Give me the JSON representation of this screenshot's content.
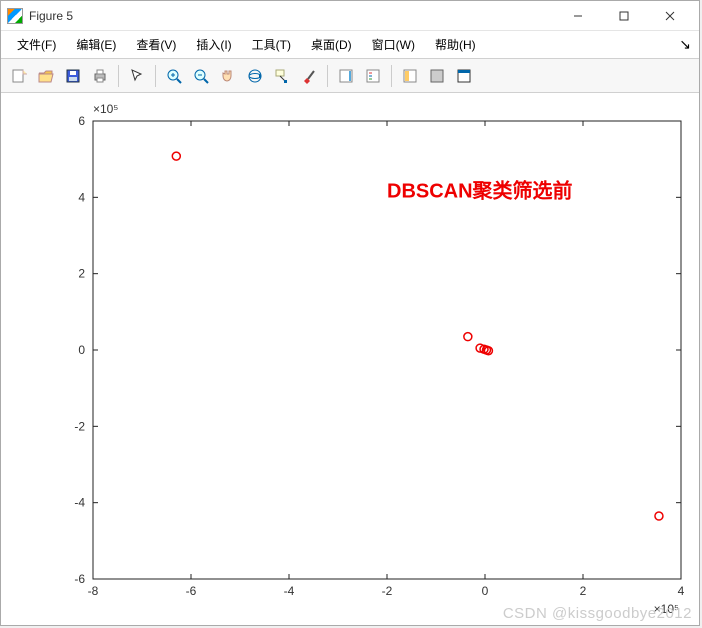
{
  "window": {
    "title": "Figure 5"
  },
  "menu": {
    "file": "文件(F)",
    "edit": "编辑(E)",
    "view": "查看(V)",
    "insert": "插入(I)",
    "tools": "工具(T)",
    "desktop": "桌面(D)",
    "window": "窗口(W)",
    "help": "帮助(H)"
  },
  "toolbar": {
    "icons": [
      "new-figure",
      "open",
      "save",
      "print",
      "pointer",
      "zoom-in",
      "zoom-out",
      "pan",
      "rotate3d",
      "data-cursor",
      "brush",
      "insert-colorbar",
      "insert-legend",
      "link-plot",
      "hide-tools",
      "dock"
    ]
  },
  "watermark": "CSDN @kissgoodbye2012",
  "chart_data": {
    "type": "scatter",
    "title": "",
    "annotation": "DBSCAN聚类筛选前",
    "xlabel": "",
    "ylabel": "",
    "xlim": [
      -8,
      4
    ],
    "ylim": [
      -6,
      6
    ],
    "x_exponent_label": "×10⁵",
    "y_exponent_label": "×10⁵",
    "x_ticks": [
      -8,
      -6,
      -4,
      -2,
      0,
      2,
      4
    ],
    "y_ticks": [
      -6,
      -4,
      -2,
      0,
      2,
      4,
      6
    ],
    "series": [
      {
        "name": "points",
        "marker": "circle-open",
        "color": "#ee0000",
        "points": [
          {
            "x": -6.3,
            "y": 5.08
          },
          {
            "x": -0.35,
            "y": 0.35
          },
          {
            "x": -0.1,
            "y": 0.05
          },
          {
            "x": -0.02,
            "y": 0.02
          },
          {
            "x": 0.03,
            "y": 0.0
          },
          {
            "x": 0.07,
            "y": -0.02
          },
          {
            "x": 3.55,
            "y": -4.35
          }
        ]
      }
    ]
  }
}
